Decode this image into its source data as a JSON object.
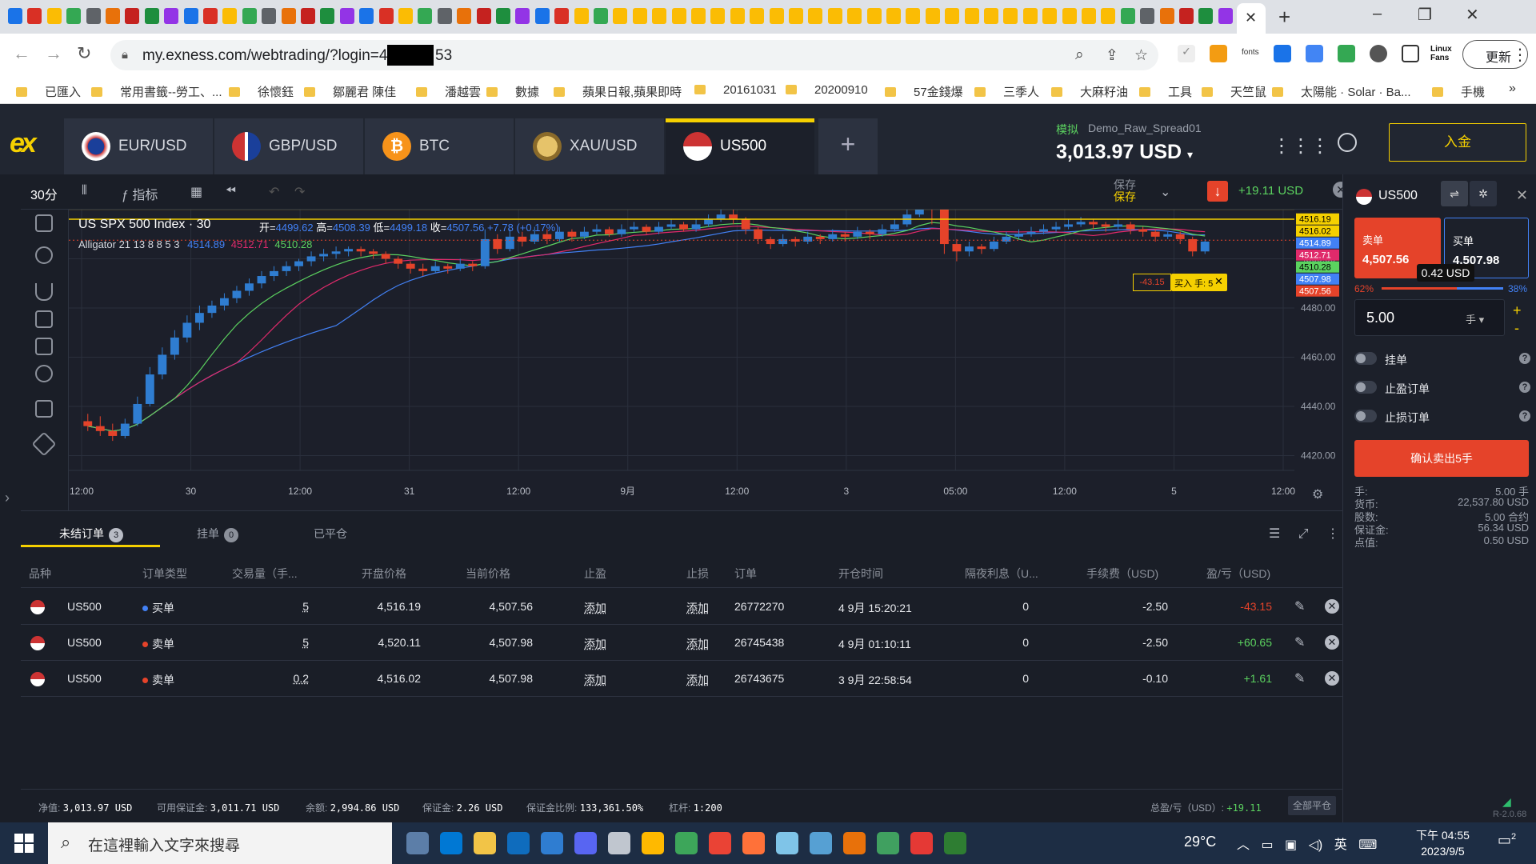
{
  "browser": {
    "url": "my.exness.com/webtrading/?login=4",
    "url_tail": "53",
    "update_label": "更新",
    "fonts_label": "fonts",
    "linux_label": "Linux Fans",
    "bookmarks": [
      "已匯入",
      "常用書籤--勞工、...",
      "徐懷鈺",
      "鄒麗君 陳佳",
      "潘越雲",
      "數據",
      "蘋果日報,蘋果即時",
      "20161031",
      "20200910",
      "57金錢爆",
      "三季人",
      "大麻籽油",
      "工具",
      "天竺鼠",
      "太陽能 · Solar · Ba...",
      "手機"
    ]
  },
  "header": {
    "logo": "ex",
    "symbol_tabs": [
      {
        "label": "EUR/USD",
        "active": false
      },
      {
        "label": "GBP/USD",
        "active": false
      },
      {
        "label": "BTC",
        "active": false
      },
      {
        "label": "XAU/USD",
        "active": false
      },
      {
        "label": "US500",
        "active": true
      }
    ],
    "account_mode": "模拟",
    "account_name": "Demo_Raw_Spread01",
    "balance": "3,013.97 USD",
    "deposit_label": "入金",
    "colors": {
      "accent": "#f5d000",
      "sell": "#e5432a",
      "buy": "#4281f5",
      "profit": "#5bd25f"
    }
  },
  "toolbar": {
    "timeframe": "30分",
    "indicators_label": "指标",
    "save_label": "保存",
    "save_sub": "保存",
    "pnl": "+19.11 USD"
  },
  "chart_data": {
    "type": "candlestick",
    "title": "US SPX 500 Index · 30",
    "ohlc": {
      "open_label": "开",
      "open": "4499.62",
      "high_label": "高",
      "high": "4508.39",
      "low_label": "低",
      "low": "4499.18",
      "close_label": "收",
      "close": "4507.56",
      "change": "+7.78 (+0.17%)"
    },
    "indicator_name": "Alligator 21 13 8 8 5 3",
    "indicator_values": [
      {
        "value": "4514.89",
        "color": "#4281f5"
      },
      {
        "value": "4512.71",
        "color": "#e02a6b"
      },
      {
        "value": "4510.28",
        "color": "#5bd25f"
      }
    ],
    "x_tick_labels": [
      "12:00",
      "30",
      "12:00",
      "31",
      "12:00",
      "9月",
      "12:00",
      "3",
      "05:00",
      "12:00",
      "5",
      "12:00"
    ],
    "y_ticks": [
      4500,
      4480,
      4460,
      4440,
      4420
    ],
    "y_tick_labels": [
      "4500.00",
      "4480.00",
      "4460.00",
      "4440.00",
      "4420.00"
    ],
    "y_range": [
      4414,
      4520
    ],
    "price_labels": [
      {
        "value": "4516.19",
        "price": 4516.19,
        "bg": "#f5d000",
        "fg": "#000"
      },
      {
        "value": "4516.02",
        "price": 4516.02,
        "bg": "#f5d000",
        "fg": "#000"
      },
      {
        "value": "4514.89",
        "price": 4514.89,
        "bg": "#4281f5",
        "fg": "#fff"
      },
      {
        "value": "4512.71",
        "price": 4512.71,
        "bg": "#e02a6b",
        "fg": "#fff"
      },
      {
        "value": "4510.28",
        "price": 4510.28,
        "bg": "#5bd25f",
        "fg": "#000"
      },
      {
        "value": "4507.98",
        "price": 4507.98,
        "bg": "#4281f5",
        "fg": "#fff"
      },
      {
        "value": "4507.56",
        "price": 4507.56,
        "bg": "#e5432a",
        "fg": "#fff"
      }
    ],
    "position_lines": [
      4516.19,
      4516.02,
      4520.11
    ],
    "order_badge": {
      "pnl": "-43.15",
      "label": "买入 手: 5"
    },
    "candles": [
      [
        4434,
        4432,
        4437,
        4430
      ],
      [
        4432,
        4430,
        4436,
        4428
      ],
      [
        4430,
        4428,
        4433,
        4426
      ],
      [
        4428,
        4433,
        4435,
        4427
      ],
      [
        4433,
        4441,
        4444,
        4432
      ],
      [
        4441,
        4453,
        4456,
        4440
      ],
      [
        4453,
        4461,
        4464,
        4451
      ],
      [
        4461,
        4468,
        4471,
        4459
      ],
      [
        4468,
        4474,
        4477,
        4466
      ],
      [
        4474,
        4478,
        4481,
        4471
      ],
      [
        4478,
        4481,
        4483,
        4476
      ],
      [
        4481,
        4484,
        4486,
        4479
      ],
      [
        4484,
        4487,
        4489,
        4482
      ],
      [
        4487,
        4490,
        4492,
        4485
      ],
      [
        4490,
        4493,
        4495,
        4488
      ],
      [
        4493,
        4495,
        4497,
        4491
      ],
      [
        4495,
        4497,
        4499,
        4493
      ],
      [
        4497,
        4499,
        4500,
        4495
      ],
      [
        4499,
        4501,
        4503,
        4497
      ],
      [
        4501,
        4502,
        4504,
        4499
      ],
      [
        4502,
        4503,
        4505,
        4500
      ],
      [
        4503,
        4504,
        4505,
        4501
      ],
      [
        4504,
        4503,
        4505,
        4501
      ],
      [
        4503,
        4502,
        4504,
        4500
      ],
      [
        4502,
        4500,
        4503,
        4498
      ],
      [
        4500,
        4498,
        4501,
        4496
      ],
      [
        4498,
        4496,
        4499,
        4494
      ],
      [
        4496,
        4495,
        4498,
        4493
      ],
      [
        4495,
        4497,
        4499,
        4494
      ],
      [
        4497,
        4496,
        4498,
        4494
      ],
      [
        4496,
        4498,
        4500,
        4495
      ],
      [
        4498,
        4497,
        4499,
        4495
      ],
      [
        4497,
        4508,
        4512,
        4496
      ],
      [
        4508,
        4504,
        4510,
        4502
      ],
      [
        4504,
        4509,
        4512,
        4503
      ],
      [
        4509,
        4507,
        4511,
        4505
      ],
      [
        4507,
        4510,
        4513,
        4506
      ],
      [
        4510,
        4508,
        4512,
        4506
      ],
      [
        4508,
        4511,
        4513,
        4507
      ],
      [
        4511,
        4509,
        4512,
        4507
      ],
      [
        4509,
        4511,
        4513,
        4508
      ],
      [
        4511,
        4512,
        4514,
        4510
      ],
      [
        4512,
        4510,
        4513,
        4509
      ],
      [
        4510,
        4512,
        4514,
        4509
      ],
      [
        4512,
        4513,
        4515,
        4511
      ],
      [
        4513,
        4511,
        4514,
        4510
      ],
      [
        4511,
        4513,
        4515,
        4510
      ],
      [
        4513,
        4514,
        4516,
        4512
      ],
      [
        4514,
        4512,
        4515,
        4511
      ],
      [
        4512,
        4514,
        4516,
        4511
      ],
      [
        4514,
        4516,
        4518,
        4513
      ],
      [
        4516,
        4518,
        4522,
        4515
      ],
      [
        4518,
        4516,
        4520,
        4514
      ],
      [
        4516,
        4512,
        4517,
        4510
      ],
      [
        4512,
        4508,
        4513,
        4506
      ],
      [
        4508,
        4506,
        4509,
        4504
      ],
      [
        4506,
        4508,
        4510,
        4505
      ],
      [
        4508,
        4507,
        4509,
        4505
      ],
      [
        4507,
        4509,
        4511,
        4506
      ],
      [
        4509,
        4508,
        4510,
        4506
      ],
      [
        4508,
        4510,
        4512,
        4507
      ],
      [
        4510,
        4509,
        4511,
        4507
      ],
      [
        4509,
        4511,
        4513,
        4508
      ],
      [
        4511,
        4510,
        4512,
        4508
      ],
      [
        4510,
        4512,
        4514,
        4509
      ],
      [
        4512,
        4514,
        4516,
        4511
      ],
      [
        4514,
        4518,
        4526,
        4513
      ],
      [
        4518,
        4524,
        4530,
        4517
      ],
      [
        4524,
        4520,
        4526,
        4514
      ],
      [
        4520,
        4506,
        4521,
        4502
      ],
      [
        4506,
        4503,
        4508,
        4499
      ],
      [
        4503,
        4505,
        4507,
        4501
      ],
      [
        4505,
        4504,
        4506,
        4502
      ],
      [
        4504,
        4507,
        4509,
        4503
      ],
      [
        4507,
        4509,
        4511,
        4506
      ],
      [
        4509,
        4510,
        4512,
        4508
      ],
      [
        4510,
        4511,
        4513,
        4509
      ],
      [
        4511,
        4512,
        4514,
        4510
      ],
      [
        4512,
        4513,
        4515,
        4511
      ],
      [
        4513,
        4514,
        4516,
        4512
      ],
      [
        4514,
        4515,
        4517,
        4513
      ],
      [
        4515,
        4514,
        4516,
        4512
      ],
      [
        4514,
        4513,
        4515,
        4511
      ],
      [
        4513,
        4514,
        4516,
        4512
      ],
      [
        4514,
        4512,
        4515,
        4510
      ],
      [
        4512,
        4511,
        4513,
        4509
      ],
      [
        4511,
        4509,
        4512,
        4507
      ],
      [
        4509,
        4510,
        4511,
        4508
      ],
      [
        4510,
        4508,
        4511,
        4506
      ],
      [
        4508,
        4503,
        4509,
        4501
      ],
      [
        4503,
        4507,
        4508,
        4502
      ]
    ]
  },
  "order_panel": {
    "symbol": "US500",
    "sell_label": "卖单",
    "sell_price": "4,507.56",
    "buy_label": "买单",
    "buy_price": "4,507.98",
    "spread": "0.42 USD",
    "sell_pct": "62%",
    "buy_pct": "38%",
    "lots": "5.00",
    "lot_unit": "手 ▾",
    "toggles": [
      "挂单",
      "止盈订单",
      "止损订单"
    ],
    "confirm_label": "确认卖出5手",
    "summary": [
      {
        "k": "手:",
        "v": "5.00 手"
      },
      {
        "k": "货币:",
        "v": "22,537.80 USD"
      },
      {
        "k": "股数:",
        "v": "5.00 合约"
      },
      {
        "k": "保证金:",
        "v": "56.34 USD"
      },
      {
        "k": "点值:",
        "v": "0.50 USD"
      }
    ]
  },
  "positions": {
    "tabs": [
      {
        "label": "未结订单",
        "count": "3"
      },
      {
        "label": "挂单",
        "count": "0"
      },
      {
        "label": "已平仓",
        "count": ""
      }
    ],
    "columns": [
      "品种",
      "订单类型",
      "交易量（手...",
      "开盘价格",
      "当前价格",
      "止盈",
      "止损",
      "订单",
      "开仓时间",
      "隔夜利息（U...",
      "手续费（USD)",
      "盈/亏（USD)"
    ],
    "rows": [
      {
        "symbol": "US500",
        "type": "买单",
        "type_color": "#4281f5",
        "volume": "5",
        "open": "4,516.19",
        "current": "4,507.56",
        "tp": "添加",
        "sl": "添加",
        "order": "26772270",
        "time": "4 9月 15:20:21",
        "swap": "0",
        "fee": "-2.50",
        "pnl": "-43.15",
        "pnl_color": "#e5432a"
      },
      {
        "symbol": "US500",
        "type": "卖单",
        "type_color": "#e5432a",
        "volume": "5",
        "open": "4,520.11",
        "current": "4,507.98",
        "tp": "添加",
        "sl": "添加",
        "order": "26745438",
        "time": "4 9月 01:10:11",
        "swap": "0",
        "fee": "-2.50",
        "pnl": "+60.65",
        "pnl_color": "#5bd25f"
      },
      {
        "symbol": "US500",
        "type": "卖单",
        "type_color": "#e5432a",
        "volume": "0.2",
        "open": "4,516.02",
        "current": "4,507.98",
        "tp": "添加",
        "sl": "添加",
        "order": "26743675",
        "time": "3 9月 22:58:54",
        "swap": "0",
        "fee": "-0.10",
        "pnl": "+1.61",
        "pnl_color": "#5bd25f"
      }
    ]
  },
  "status": {
    "equity_label": "净值:",
    "equity": "3,013.97 USD",
    "free_margin_label": "可用保证金:",
    "free_margin": "3,011.71 USD",
    "balance_label": "余额:",
    "balance": "2,994.86 USD",
    "margin_label": "保证金:",
    "margin": "2.26 USD",
    "margin_level_label": "保证金比例:",
    "margin_level": "133,361.50%",
    "leverage_label": "杠杆:",
    "leverage": "1:200",
    "total_pnl_label": "总盈/亏（USD）:",
    "total_pnl": "+19.11",
    "close_all_label": "全部平仓",
    "version": "R-2.0.68"
  },
  "taskbar": {
    "search_placeholder": "在這裡輸入文字來搜尋",
    "weather": "29°C",
    "ime": "英",
    "time": "下午 04:55",
    "date": "2023/9/5",
    "notif_count": "2"
  }
}
